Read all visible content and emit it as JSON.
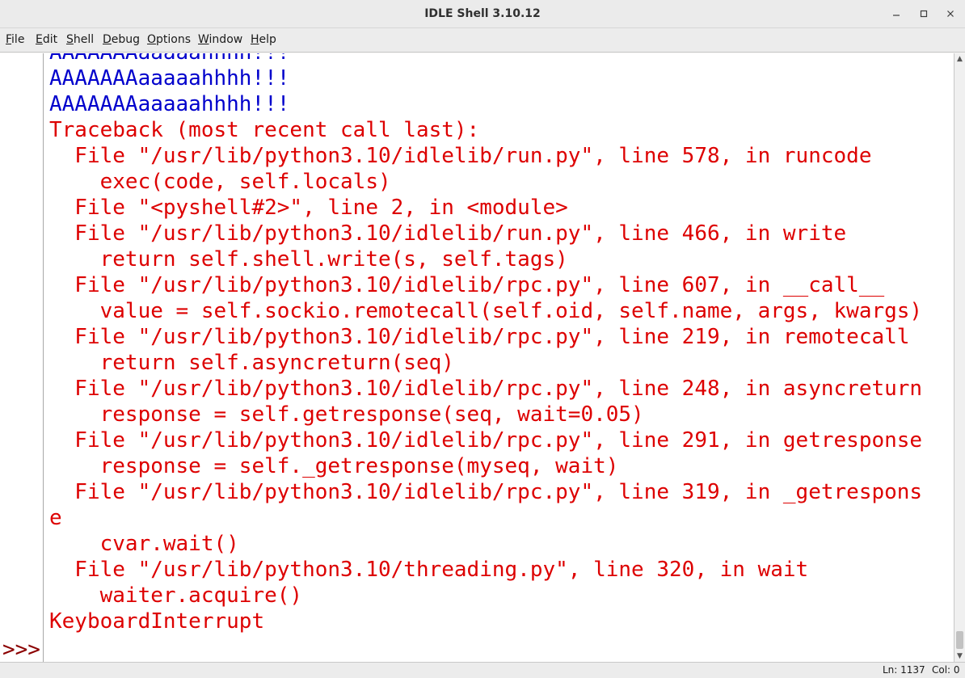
{
  "window": {
    "title": "IDLE Shell 3.10.12",
    "minimize_icon": "minimize-icon",
    "maximize_icon": "maximize-icon",
    "close_icon": "close-icon"
  },
  "menu": {
    "items": [
      {
        "label": "File",
        "underline": "F",
        "rest": "ile"
      },
      {
        "label": "Edit",
        "underline": "E",
        "rest": "dit"
      },
      {
        "label": "Shell",
        "underline": "S",
        "rest": "hell"
      },
      {
        "label": "Debug",
        "underline": "D",
        "rest": "ebug"
      },
      {
        "label": "Options",
        "underline": "O",
        "rest": "ptions"
      },
      {
        "label": "Window",
        "underline": "W",
        "rest": "indow"
      },
      {
        "label": "Help",
        "underline": "H",
        "rest": "elp"
      }
    ]
  },
  "shell": {
    "prompt": ">>>",
    "lines": [
      {
        "kind": "stdout",
        "text": "AAAAAAAaaaaahhhh!!!"
      },
      {
        "kind": "stdout",
        "text": "AAAAAAAaaaaahhhh!!!"
      },
      {
        "kind": "stdout",
        "text": "AAAAAAAaaaaahhhh!!!"
      },
      {
        "kind": "stderr",
        "text": "Traceback (most recent call last):"
      },
      {
        "kind": "stderr",
        "text": "  File \"/usr/lib/python3.10/idlelib/run.py\", line 578, in runcode"
      },
      {
        "kind": "stderr",
        "text": "    exec(code, self.locals)"
      },
      {
        "kind": "stderr",
        "text": "  File \"<pyshell#2>\", line 2, in <module>"
      },
      {
        "kind": "stderr",
        "text": "  File \"/usr/lib/python3.10/idlelib/run.py\", line 466, in write"
      },
      {
        "kind": "stderr",
        "text": "    return self.shell.write(s, self.tags)"
      },
      {
        "kind": "stderr",
        "text": "  File \"/usr/lib/python3.10/idlelib/rpc.py\", line 607, in __call__"
      },
      {
        "kind": "stderr",
        "text": "    value = self.sockio.remotecall(self.oid, self.name, args, kwargs)"
      },
      {
        "kind": "stderr",
        "text": "  File \"/usr/lib/python3.10/idlelib/rpc.py\", line 219, in remotecall"
      },
      {
        "kind": "stderr",
        "text": "    return self.asyncreturn(seq)"
      },
      {
        "kind": "stderr",
        "text": "  File \"/usr/lib/python3.10/idlelib/rpc.py\", line 248, in asyncreturn"
      },
      {
        "kind": "stderr",
        "text": "    response = self.getresponse(seq, wait=0.05)"
      },
      {
        "kind": "stderr",
        "text": "  File \"/usr/lib/python3.10/idlelib/rpc.py\", line 291, in getresponse"
      },
      {
        "kind": "stderr",
        "text": "    response = self._getresponse(myseq, wait)"
      },
      {
        "kind": "stderr",
        "text": "  File \"/usr/lib/python3.10/idlelib/rpc.py\", line 319, in _getrespons"
      },
      {
        "kind": "stderr",
        "text": "e"
      },
      {
        "kind": "stderr",
        "text": "    cvar.wait()"
      },
      {
        "kind": "stderr",
        "text": "  File \"/usr/lib/python3.10/threading.py\", line 320, in wait"
      },
      {
        "kind": "stderr",
        "text": "    waiter.acquire()"
      },
      {
        "kind": "stderr",
        "text": "KeyboardInterrupt"
      }
    ]
  },
  "status": {
    "ln": "Ln: 1137",
    "col": "Col: 0"
  },
  "colors": {
    "stdout": "#0000cc",
    "stderr": "#dd0000",
    "prompt": "#8b0000"
  }
}
